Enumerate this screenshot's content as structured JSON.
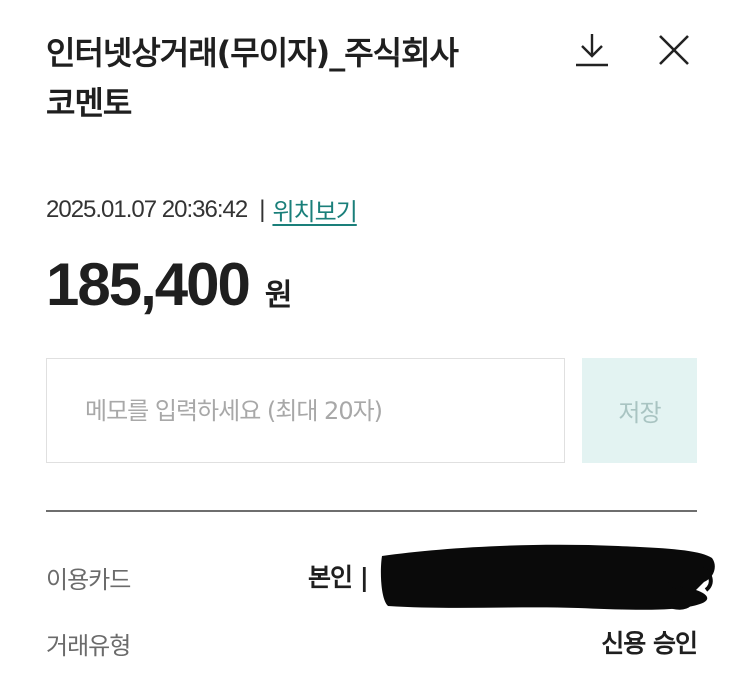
{
  "header": {
    "title_line1": "인터넷상거래(무이자)_주식회사",
    "title_line2": "코멘토",
    "download_icon": "download-icon",
    "close_icon": "close-icon"
  },
  "transaction": {
    "datetime": "2025.01.07 20:36:42",
    "separator": "|",
    "location_link": "위치보기",
    "amount": "185,400",
    "currency": "원"
  },
  "memo": {
    "placeholder": "메모를 입력하세요 (최대 20자)",
    "value": "",
    "save_label": "저장"
  },
  "details": {
    "card_label": "이용카드",
    "card_value": "본인 |",
    "type_label": "거래유형",
    "type_value": "신용 승인"
  },
  "colors": {
    "link": "#1a7f7a",
    "save_button_bg": "#e3f3f2",
    "save_button_text": "#a9c4c2"
  }
}
